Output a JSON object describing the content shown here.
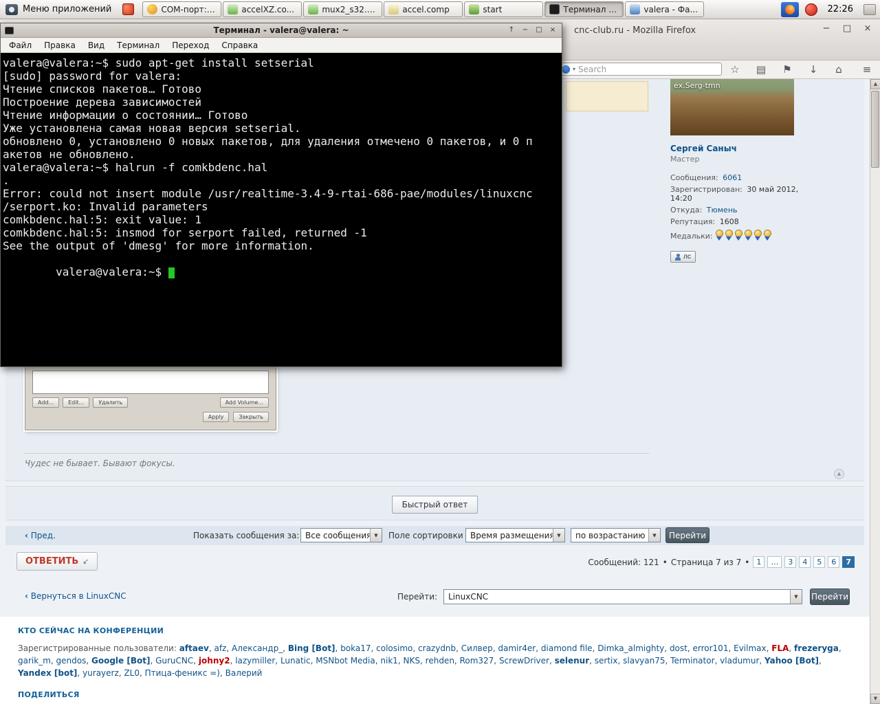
{
  "glyphs": {
    "select_caret": "▾",
    "select_arrow": "▼",
    "star": "☆",
    "library": "▤",
    "bookmark_flag": "⚑",
    "download_arrow": "↓",
    "home": "⌂",
    "menu": "≡",
    "scroll_up": "▲",
    "scroll_down": "▼",
    "win_minimize": "−",
    "win_maximize": "□",
    "win_close": "×",
    "term_shade": "↑",
    "back_arrow": "‹",
    "bullet": "•",
    "top_arrow": "▲",
    "reply_arrow": "↙"
  },
  "taskbar": {
    "menu_label": "Меню приложений",
    "clock": "22:26",
    "windows": [
      {
        "label": "COM-порт: ...",
        "icon": "serial"
      },
      {
        "label": "accelXZ.co...",
        "icon": "code"
      },
      {
        "label": "mux2_s32.c...",
        "icon": "code"
      },
      {
        "label": "accel.comp",
        "icon": "comp"
      },
      {
        "label": "start",
        "icon": "start"
      },
      {
        "label": "Терминал -...",
        "icon": "terminal",
        "active": true
      },
      {
        "label": "valera - Фа...",
        "icon": "files"
      }
    ]
  },
  "browser": {
    "window_title": "cnc-club.ru - Mozilla Firefox",
    "search_placeholder": "Search"
  },
  "terminal": {
    "title": "Терминал - valera@valera: ~",
    "menu": [
      "Файл",
      "Правка",
      "Вид",
      "Терминал",
      "Переход",
      "Справка"
    ],
    "lines": [
      "valera@valera:~$ sudo apt-get install setserial",
      "[sudo] password for valera:",
      "Чтение списков пакетов… Готово",
      "Построение дерева зависимостей",
      "Чтение информации о состоянии… Готово",
      "Уже установлена самая новая версия setserial.",
      "обновлено 0, установлено 0 новых пакетов, для удаления отмечено 0 пакетов, и 0 п",
      "акетов не обновлено.",
      "valera@valera:~$ halrun -f comkbdenc.hal",
      ".",
      "Error: could not insert module /usr/realtime-3.4-9-rtai-686-pae/modules/linuxcnc",
      "/serport.ko: Invalid parameters",
      "comkbdenc.hal:5: exit value: 1",
      "comkbdenc.hal:5: insmod for serport failed, returned -1",
      "See the output of 'dmesg' for more information."
    ],
    "prompt": "valera@valera:~$ "
  },
  "forum": {
    "profile": {
      "avatar_caption": "ex.Serg-tmn",
      "username": "Сергей Саныч",
      "rank": "Мастер",
      "fields": [
        {
          "label": "Сообщения:",
          "value": "6061",
          "link": true
        },
        {
          "label": "Зарегистрирован:",
          "value": "30 май 2012, 14:20"
        },
        {
          "label": "Откуда:",
          "value": "Тюмень",
          "link": true
        },
        {
          "label": "Репутация:",
          "value": "1608"
        }
      ],
      "medals_label": "Медальки:",
      "medals": [
        1,
        2,
        3,
        4,
        5,
        6
      ],
      "pm_label": "лс"
    },
    "post": {
      "signature": "Чудес не бывает. Бывают фокусы.",
      "attachment_dialog": {
        "top_buttons": [
          "Add...",
          "Edit...",
          "Удалить"
        ],
        "right_button": "Add Volume...",
        "bottom_buttons": [
          "Apply",
          "Закрыть"
        ]
      }
    },
    "quick_reply_label": "Быстрый ответ",
    "display_bar": {
      "prev_label": "Пред.",
      "show_label": "Показать сообщения за:",
      "show_value": "Все сообщения",
      "sort_label": "Поле сортировки",
      "sort_value": "Время размещения",
      "order_value": "по возрастанию",
      "go_label": "Перейти"
    },
    "reply_label": "ОТВЕТИТЬ",
    "posts_count_label": "Сообщений: 121",
    "page_label": "Страница 7 из 7",
    "pagination": [
      {
        "label": "1"
      },
      {
        "label": "…",
        "gap": true
      },
      {
        "label": "3"
      },
      {
        "label": "4"
      },
      {
        "label": "5"
      },
      {
        "label": "6"
      },
      {
        "label": "7",
        "current": true
      }
    ],
    "return_label": "Вернуться в LinuxCNC",
    "jump_label": "Перейти:",
    "jump_value": "LinuxCNC",
    "jump_go_label": "Перейти",
    "online": {
      "heading": "КТО СЕЙЧАС НА КОНФЕРЕНЦИИ",
      "registered_label": "Зарегистрированные пользователи:",
      "users": [
        {
          "name": "aftaev",
          "style": "bold"
        },
        {
          "name": "afz"
        },
        {
          "name": "Александр_"
        },
        {
          "name": "Bing [Bot]",
          "style": "bold"
        },
        {
          "name": "boka17"
        },
        {
          "name": "colosimo"
        },
        {
          "name": "crazydnb"
        },
        {
          "name": "Силвер"
        },
        {
          "name": "damir4er"
        },
        {
          "name": "diamond file"
        },
        {
          "name": "Dimka_almighty"
        },
        {
          "name": "dost"
        },
        {
          "name": "error101"
        },
        {
          "name": "Evilmax"
        },
        {
          "name": "FLA",
          "style": "red"
        },
        {
          "name": "frezeryga",
          "style": "bold"
        },
        {
          "name": "garik_m"
        },
        {
          "name": "gendos"
        },
        {
          "name": "Google [Bot]",
          "style": "bold"
        },
        {
          "name": "GuruCNC"
        },
        {
          "name": "johny2",
          "style": "red"
        },
        {
          "name": "lazymiller"
        },
        {
          "name": "Lunatic"
        },
        {
          "name": "MSNbot Media"
        },
        {
          "name": "nik1"
        },
        {
          "name": "NKS"
        },
        {
          "name": "rehden"
        },
        {
          "name": "Rom327"
        },
        {
          "name": "ScrewDriver"
        },
        {
          "name": "selenur",
          "style": "bold"
        },
        {
          "name": "sertix"
        },
        {
          "name": "slavyan75"
        },
        {
          "name": "Terminator"
        },
        {
          "name": "vladumur"
        },
        {
          "name": "Yahoo [Bot]",
          "style": "bold"
        },
        {
          "name": "Yandex [bot]",
          "style": "bold"
        },
        {
          "name": "yurayerz"
        },
        {
          "name": "ZL0"
        },
        {
          "name": "Птица-феникс =)"
        },
        {
          "name": "Валерий"
        }
      ]
    },
    "share_heading": "ПОДЕЛИТЬСЯ"
  }
}
